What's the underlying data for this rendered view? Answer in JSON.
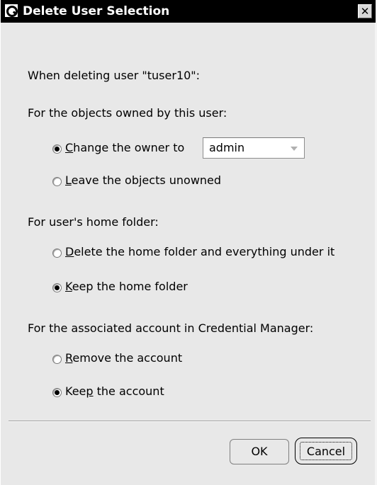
{
  "window": {
    "title": "Delete User Selection",
    "close_glyph": "✕"
  },
  "intro": "When deleting user \"tuser10\":",
  "objects_section": {
    "heading": "For the objects owned by this user:",
    "change_owner_mnemonic": "C",
    "change_owner_label_rest": "hange the owner to",
    "owner_select_value": "admin",
    "leave_unowned_mnemonic": "L",
    "leave_unowned_label_rest": "eave the objects unowned",
    "selected": "change_owner"
  },
  "home_section": {
    "heading": "For user's home folder:",
    "delete_mnemonic": "D",
    "delete_label_rest": "elete the home folder and everything under it",
    "keep_mnemonic": "K",
    "keep_label_rest": "eep the home folder",
    "selected": "keep"
  },
  "credential_section": {
    "heading": "For the associated account in Credential Manager:",
    "remove_mnemonic": "R",
    "remove_label_rest": "emove the account",
    "keep_prefix": "Kee",
    "keep_mnemonic": "p",
    "keep_suffix": " the account",
    "selected": "keep"
  },
  "buttons": {
    "ok": "OK",
    "cancel": "Cancel"
  },
  "icons": {
    "app": "search-magnifier-icon",
    "close": "close-icon",
    "dropdown": "chevron-down-icon"
  }
}
